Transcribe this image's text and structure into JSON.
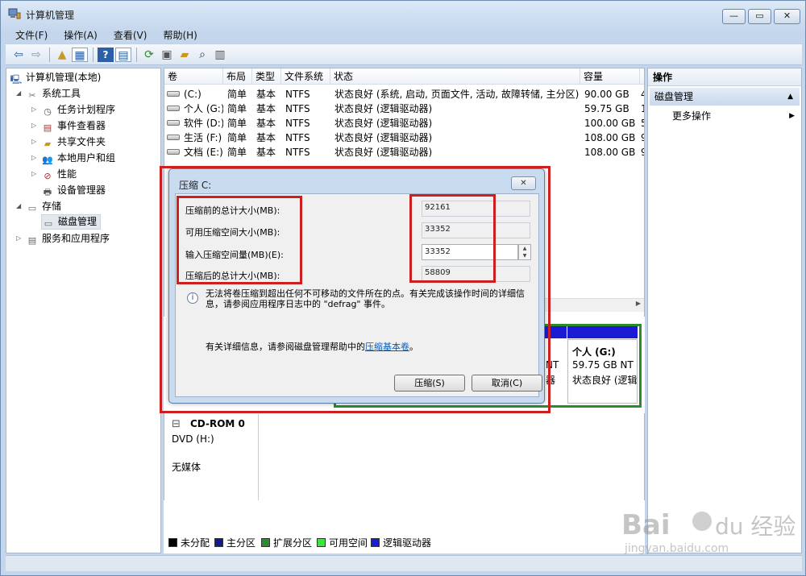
{
  "window": {
    "title": "计算机管理",
    "buttons": {
      "minimize": "—",
      "maximize": "▭",
      "close": "✕"
    }
  },
  "menu": [
    "文件(F)",
    "操作(A)",
    "查看(V)",
    "帮助(H)"
  ],
  "toolbar_icons": [
    "back-icon",
    "forward-icon",
    "up-folder-icon",
    "show-hide-tree-icon",
    "help-icon",
    "properties-pane-icon",
    "refresh-icon",
    "properties-icon",
    "open-folder-icon",
    "search-icon",
    "export-icon"
  ],
  "tree": {
    "root": "计算机管理(本地)",
    "system_tools": "系统工具",
    "task_scheduler": "任务计划程序",
    "event_viewer": "事件查看器",
    "shared_folders": "共享文件夹",
    "local_users": "本地用户和组",
    "performance": "性能",
    "device_manager": "设备管理器",
    "storage": "存储",
    "disk_management": "磁盘管理",
    "services": "服务和应用程序"
  },
  "list": {
    "headers": [
      "卷",
      "布局",
      "类型",
      "文件系统",
      "状态",
      "容量"
    ],
    "rows": [
      {
        "volume": "(C:)",
        "layout": "简单",
        "type": "基本",
        "fs": "NTFS",
        "status": "状态良好 (系统, 启动, 页面文件, 活动, 故障转储, 主分区)",
        "capacity": "90.00 GB",
        "extra": "4"
      },
      {
        "volume": "个人 (G:)",
        "layout": "简单",
        "type": "基本",
        "fs": "NTFS",
        "status": "状态良好 (逻辑驱动器)",
        "capacity": "59.75 GB",
        "extra": "1"
      },
      {
        "volume": "软件 (D:)",
        "layout": "简单",
        "type": "基本",
        "fs": "NTFS",
        "status": "状态良好 (逻辑驱动器)",
        "capacity": "100.00 GB",
        "extra": "5"
      },
      {
        "volume": "生活 (F:)",
        "layout": "简单",
        "type": "基本",
        "fs": "NTFS",
        "status": "状态良好 (逻辑驱动器)",
        "capacity": "108.00 GB",
        "extra": "9"
      },
      {
        "volume": "文档 (E:)",
        "layout": "简单",
        "type": "基本",
        "fs": "NTFS",
        "status": "状态良好 (逻辑驱动器)",
        "capacity": "108.00 GB",
        "extra": "9"
      }
    ]
  },
  "disk_graphic": {
    "prev_partition": {
      "line1": "NT",
      "line2": "器"
    },
    "vol_g": {
      "name": "个人 (G:)",
      "size": "59.75 GB NT",
      "status": "状态良好 (逻辑"
    },
    "cdrom": {
      "name": "CD-ROM 0",
      "drive": "DVD (H:)",
      "media": "无媒体"
    }
  },
  "legend": [
    {
      "label": "未分配",
      "color": "#000000"
    },
    {
      "label": "主分区",
      "color": "#101c8c"
    },
    {
      "label": "扩展分区",
      "color": "#2d8a2d"
    },
    {
      "label": "可用空间",
      "color": "#39e639"
    },
    {
      "label": "逻辑驱动器",
      "color": "#1b1bd6"
    }
  ],
  "actions": {
    "header": "操作",
    "section": "磁盘管理",
    "more": "更多操作"
  },
  "dialog": {
    "title": "压缩 C:",
    "labels": {
      "total_before": "压缩前的总计大小(MB):",
      "available": "可用压缩空间大小(MB):",
      "shrink_amount": "输入压缩空间量(MB)(E):",
      "total_after": "压缩后的总计大小(MB):"
    },
    "values": {
      "total_before": "92161",
      "available": "33352",
      "shrink_amount": "33352",
      "total_after": "58809"
    },
    "info": "无法将卷压缩到超出任何不可移动的文件所在的点。有关完成该操作时间的详细信息，请参阅应用程序日志中的 \"defrag\" 事件。",
    "help_prefix": "有关详细信息，请参阅磁盘管理帮助中的",
    "help_link": "压缩基本卷",
    "help_suffix": "。",
    "shrink_button": "压缩(S)",
    "cancel_button": "取消(C)"
  },
  "watermark": {
    "brand": "Bai du 经验",
    "url": "jingyan.baidu.com"
  },
  "colors": {
    "annotation_red": "#cc1f1f",
    "logical_drive_blue": "#1b1bd6",
    "extended_green": "#2d8a2d"
  }
}
